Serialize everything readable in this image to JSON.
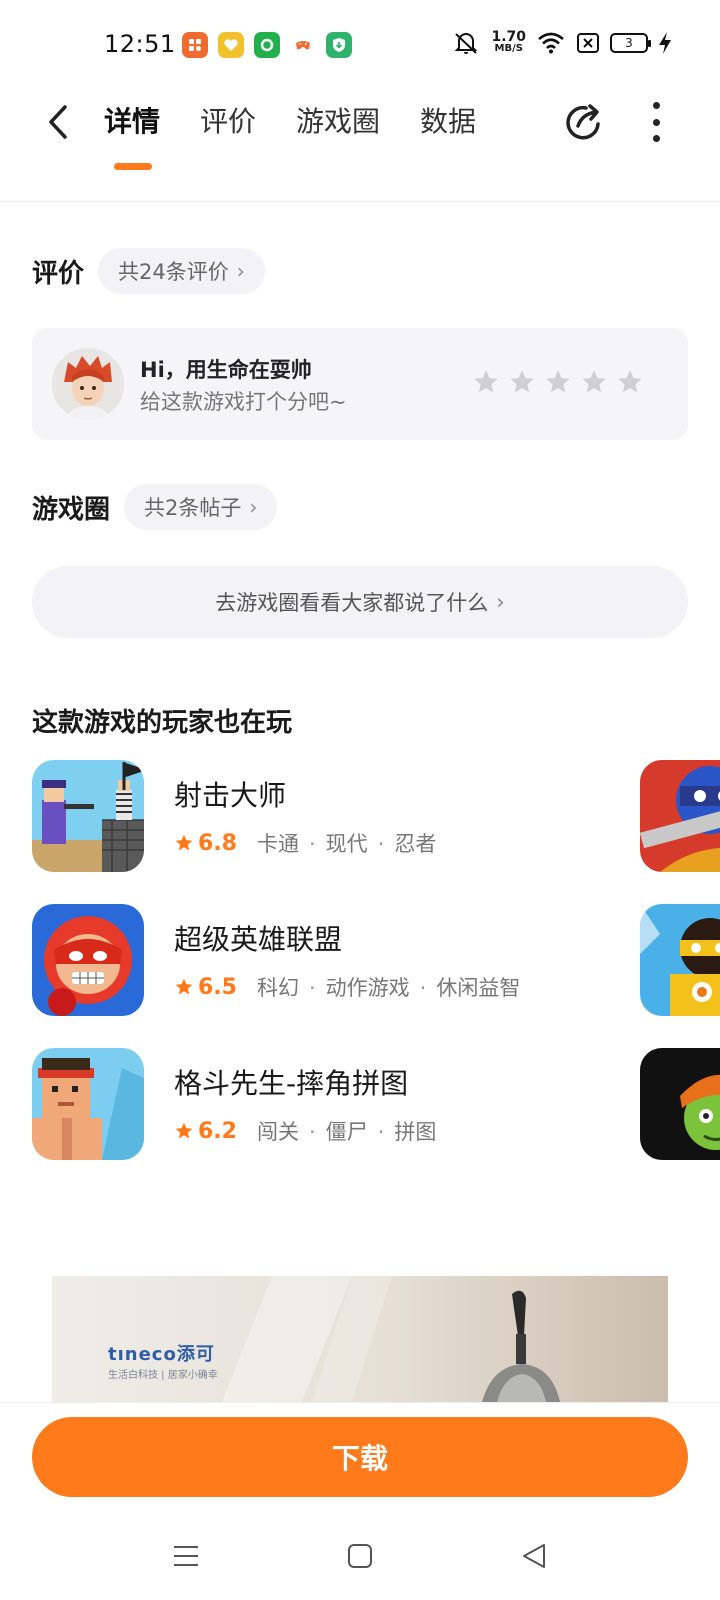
{
  "status_bar": {
    "time": "12:51",
    "net_speed_value": "1.70",
    "net_speed_unit": "MB/S",
    "battery_level": "3"
  },
  "nav": {
    "tabs": [
      {
        "label": "详情",
        "active": true
      },
      {
        "label": "评价",
        "active": false
      },
      {
        "label": "游戏圈",
        "active": false
      },
      {
        "label": "数据",
        "active": false
      }
    ],
    "accent_color": "#ff7a1a"
  },
  "reviews": {
    "title": "评价",
    "count_label": "共24条评价",
    "card": {
      "greeting": "Hi，用生命在耍帅",
      "hint": "给这款游戏打个分吧~",
      "star_count": 5
    }
  },
  "community": {
    "title": "游戏圈",
    "count_label": "共2条帖子",
    "button_label": "去游戏圈看看大家都说了什么"
  },
  "also_playing": {
    "title": "这款游戏的玩家也在玩",
    "games": [
      {
        "name": "射击大师",
        "rating": "6.8",
        "tags": [
          "卡通",
          "现代",
          "忍者"
        ]
      },
      {
        "name": "超级英雄联盟",
        "rating": "6.5",
        "tags": [
          "科幻",
          "动作游戏",
          "休闲益智"
        ]
      },
      {
        "name": "格斗先生-摔角拼图",
        "rating": "6.2",
        "tags": [
          "闯关",
          "僵尸",
          "拼图"
        ]
      }
    ]
  },
  "ad": {
    "brand": "tıneco添可",
    "tagline": "生活白科技 | 居家小确幸"
  },
  "download": {
    "label": "下载"
  }
}
